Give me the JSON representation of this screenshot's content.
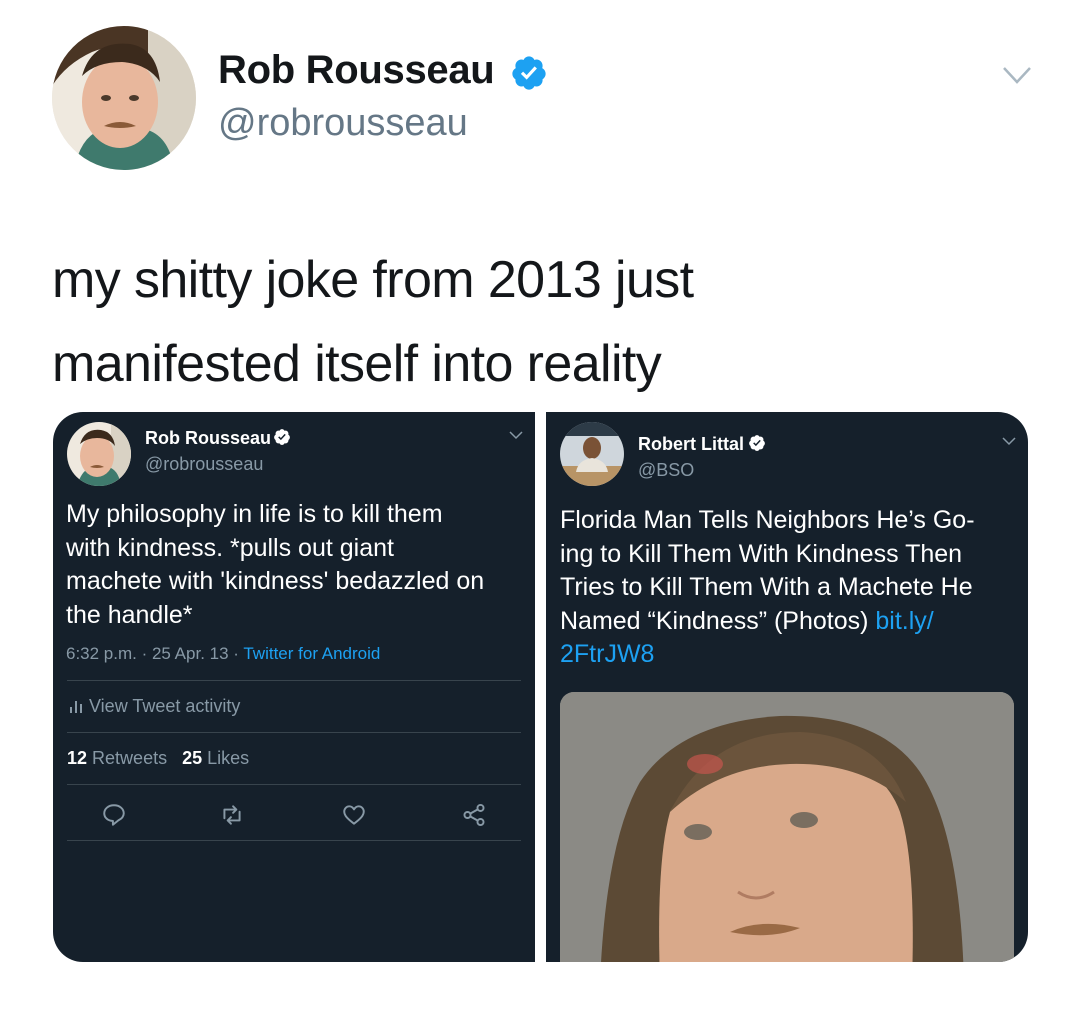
{
  "tweet": {
    "author_name": "Rob Rousseau",
    "author_handle": "@robrousseau",
    "text_line1": "my shitty joke from 2013 just",
    "text_line2": "manifested itself into reality"
  },
  "embedded_left": {
    "author_name": "Rob Rousseau",
    "author_handle": "@robrousseau",
    "text_lines": [
      "My philosophy in life is to kill them",
      "with kindness. *pulls out giant",
      "machete with 'kindness' bedazzled on",
      "the handle*"
    ],
    "time": "6:32 p.m. · 25 Apr. 13 · ",
    "source": "Twitter for Android",
    "activity_label": "View Tweet activity",
    "retweets_count": "12",
    "retweets_label": "Retweets",
    "likes_count": "25",
    "likes_label": "Likes"
  },
  "embedded_right": {
    "author_name": "Robert Littal",
    "author_handle": "@BSO",
    "text_lines": [
      "Florida Man Tells Neighbors He’s Go-",
      "ing to Kill Them With Kindness Then",
      "Tries to Kill Them With a Machete He"
    ],
    "text_line4": "Named “Kindness” (Photos) ",
    "link_part1": "bit.ly/",
    "link_part2": "2FtrJW8"
  },
  "colors": {
    "verified_blue": "#1da1f2",
    "panel_background": "#15202b",
    "link_blue": "#1da1f2",
    "muted_gray": "#8899a6"
  },
  "icons": [
    "verified-badge-icon",
    "chevron-down-icon",
    "bar-chart-icon",
    "reply-icon",
    "retweet-icon",
    "like-icon",
    "share-icon"
  ]
}
